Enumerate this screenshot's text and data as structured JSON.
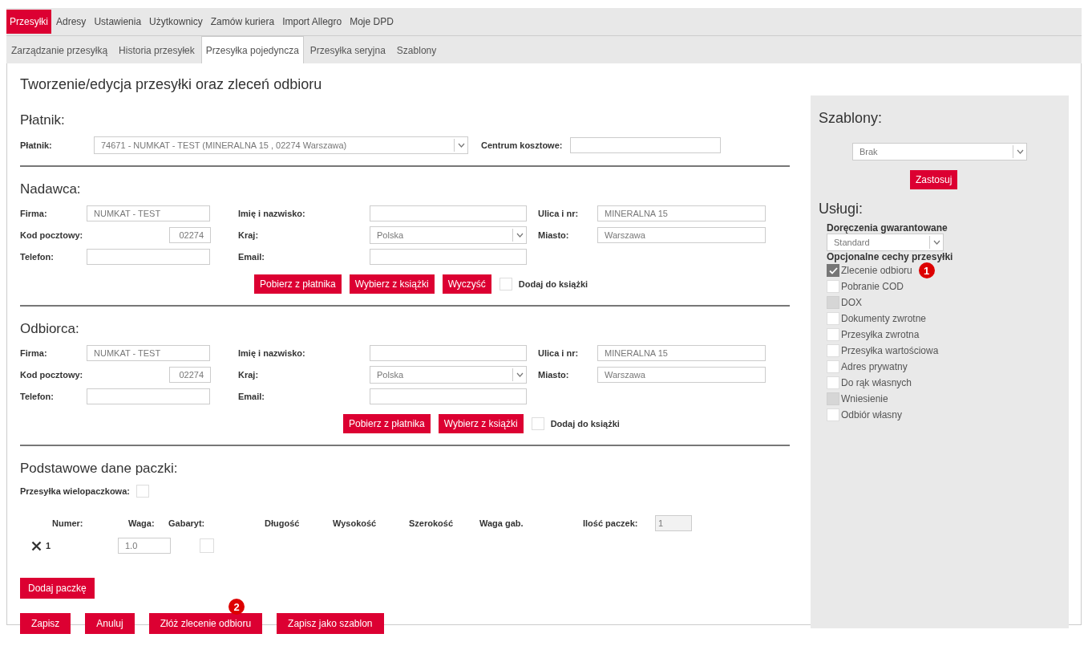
{
  "main_tabs": [
    {
      "label": "Przesyłki",
      "selected": true
    },
    {
      "label": "Adresy",
      "selected": false
    },
    {
      "label": "Ustawienia",
      "selected": false
    },
    {
      "label": "Użytkownicy",
      "selected": false
    },
    {
      "label": "Zamów kuriera",
      "selected": false
    },
    {
      "label": "Import Allegro",
      "selected": false
    },
    {
      "label": "Moje DPD",
      "selected": false
    }
  ],
  "sub_tabs": [
    {
      "label": "Zarządzanie przesyłką",
      "selected": false
    },
    {
      "label": "Historia przesyłek",
      "selected": false
    },
    {
      "label": "Przesyłka pojedyncza",
      "selected": true
    },
    {
      "label": "Przesyłka seryjna",
      "selected": false
    },
    {
      "label": "Szablony",
      "selected": false
    }
  ],
  "page_title": "Tworzenie/edycja przesyłki oraz zleceń odbioru",
  "payer": {
    "heading": "Płatnik:",
    "label": "Płatnik:",
    "value": "74671 - NUMKAT - TEST (MINERALNA 15 , 02274 Warszawa)",
    "cost_center_label": "Centrum kosztowe:"
  },
  "sender": {
    "heading": "Nadawca:",
    "fields": [
      {
        "label": "Firma:",
        "kind": "text",
        "value": "NUMKAT - TEST"
      },
      {
        "label": "Imię i nazwisko:",
        "kind": "text"
      },
      {
        "label": "Ulica i nr:",
        "kind": "text",
        "value": "MINERALNA 15"
      },
      {
        "label": "Kod pocztowy:",
        "kind": "short",
        "value": "02274"
      },
      {
        "label": "Kraj:",
        "kind": "select",
        "value": "Polska"
      },
      {
        "label": "Miasto:",
        "kind": "text",
        "value": "Warszawa"
      },
      {
        "label": "Telefon:",
        "kind": "text"
      },
      {
        "label": "Email:",
        "kind": "text"
      }
    ],
    "buttons": [
      "Pobierz z płatnika",
      "Wybierz z książki",
      "Wyczyść"
    ],
    "address_book": {
      "label": "Dodaj do książki",
      "checked": false
    }
  },
  "recipient": {
    "heading": "Odbiorca:",
    "fields": [
      {
        "label": "Firma:",
        "kind": "text",
        "value": "NUMKAT - TEST"
      },
      {
        "label": "Imię i nazwisko:",
        "kind": "text"
      },
      {
        "label": "Ulica i nr:",
        "kind": "text",
        "value": "MINERALNA 15"
      },
      {
        "label": "Kod pocztowy:",
        "kind": "short",
        "value": "02274"
      },
      {
        "label": "Kraj:",
        "kind": "select",
        "value": "Polska"
      },
      {
        "label": "Miasto:",
        "kind": "text",
        "value": "Warszawa"
      },
      {
        "label": "Telefon:",
        "kind": "text"
      },
      {
        "label": "Email:",
        "kind": "text"
      }
    ],
    "buttons": [
      "Pobierz z płatnika",
      "Wybierz z książki"
    ],
    "address_book": {
      "label": "Dodaj do książki",
      "checked": false
    }
  },
  "parcel": {
    "heading": "Podstawowe dane paczki:",
    "multi": {
      "label": "Przesyłka wielopaczkowa:",
      "checked": false
    },
    "columns": [
      "Numer:",
      "Waga:",
      "Gabaryt:",
      "Długość",
      "Wysokość",
      "Szerokość",
      "Waga gab."
    ],
    "count_label": "Ilość paczek:",
    "count": "1",
    "rows": [
      {
        "number": "1",
        "weight": "1.0",
        "oversize": false
      }
    ],
    "add_button": "Dodaj paczkę",
    "buttons": [
      {
        "label": "Zapisz"
      },
      {
        "label": "Anuluj"
      },
      {
        "label": "Złóż zlecenie odbioru",
        "annotation": "2"
      },
      {
        "label": "Zapisz jako szablon"
      }
    ]
  },
  "sidebar": {
    "templates_heading": "Szablony:",
    "template": "Brak",
    "apply_button": "Zastosuj",
    "services_heading": "Usługi:",
    "guaranteed_label": "Doręczenia gwarantowane",
    "guaranteed": "Standard",
    "optional_label": "Opcjonalne cechy przesyłki",
    "options": [
      {
        "label": "Zlecenie odbioru",
        "checked": true,
        "disabled": false,
        "annotation": "1"
      },
      {
        "label": "Pobranie COD",
        "checked": false,
        "disabled": false
      },
      {
        "label": "DOX",
        "checked": false,
        "disabled": true
      },
      {
        "label": "Dokumenty zwrotne",
        "checked": false,
        "disabled": false
      },
      {
        "label": "Przesyłka zwrotna",
        "checked": false,
        "disabled": false
      },
      {
        "label": "Przesyłka wartościowa",
        "checked": false,
        "disabled": false
      },
      {
        "label": "Adres prywatny",
        "checked": false,
        "disabled": false
      },
      {
        "label": "Do rąk własnych",
        "checked": false,
        "disabled": false
      },
      {
        "label": "Wniesienie",
        "checked": false,
        "disabled": true
      },
      {
        "label": "Odbiór własny",
        "checked": false,
        "disabled": false
      }
    ]
  }
}
